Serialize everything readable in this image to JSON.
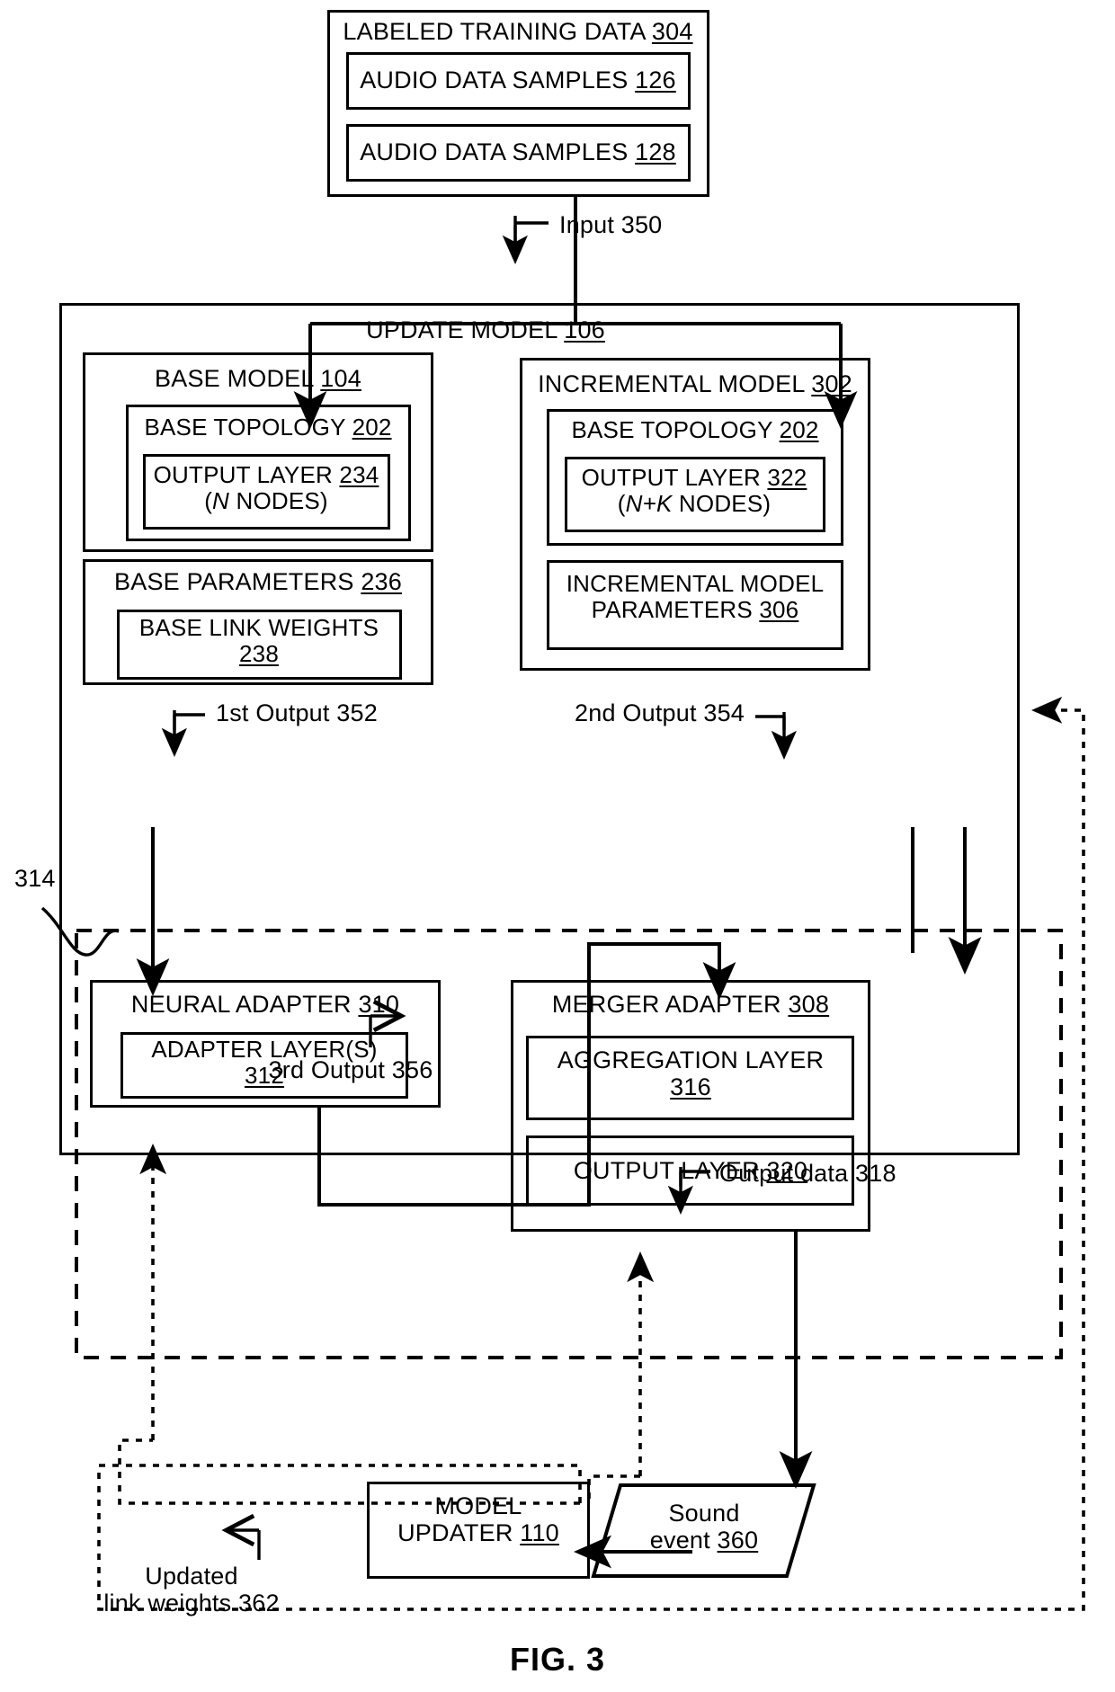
{
  "figure": {
    "caption": "FIG. 3"
  },
  "training_data": {
    "title": "LABELED TRAINING DATA",
    "ref": "304",
    "samples": [
      {
        "label": "AUDIO DATA SAMPLES",
        "ref": "126"
      },
      {
        "label": "AUDIO DATA SAMPLES",
        "ref": "128"
      }
    ]
  },
  "update_model": {
    "title": "UPDATE MODEL",
    "ref": "106",
    "base_model": {
      "title": "BASE MODEL",
      "ref": "104",
      "topology": {
        "title": "BASE TOPOLOGY",
        "ref": "202",
        "output_layer": {
          "title": "OUTPUT LAYER",
          "ref": "234",
          "nodes": "(N NODES)",
          "nodes_symbol": "N",
          "nodes_suffix": " NODES)",
          "nodes_prefix": "("
        }
      },
      "parameters": {
        "title": "BASE PARAMETERS",
        "ref": "236",
        "link_weights": {
          "title": "BASE LINK WEIGHTS",
          "ref": "238"
        }
      }
    },
    "incremental_model": {
      "title": "INCREMENTAL MODEL",
      "ref": "302",
      "topology": {
        "title": "BASE TOPOLOGY",
        "ref": "202",
        "output_layer": {
          "title": "OUTPUT LAYER",
          "ref": "322",
          "nodes_prefix": "(",
          "nodes_symbol": "N+K",
          "nodes_suffix": " NODES)"
        }
      },
      "parameters": {
        "title_line1": "INCREMENTAL MODEL",
        "title_line2": "PARAMETERS",
        "ref": "306"
      }
    },
    "neural_adapter": {
      "title": "NEURAL ADAPTER",
      "ref": "310",
      "adapter_layers": {
        "title": "ADAPTER LAYER(S)",
        "ref": "312"
      }
    },
    "merger_adapter": {
      "title": "MERGER ADAPTER",
      "ref": "308",
      "aggregation_layer": {
        "title": "AGGREGATION LAYER",
        "ref": "316"
      },
      "output_layer": {
        "title": "OUTPUT LAYER",
        "ref": "320"
      }
    },
    "dashed_region_ref": "314"
  },
  "model_updater": {
    "title_line1": "MODEL",
    "title_line2": "UPDATER",
    "ref": "110"
  },
  "sound_event": {
    "line1": "Sound",
    "line2_label": "event",
    "ref": "360"
  },
  "flow_labels": {
    "input": "Input 350",
    "first_output": "1st Output 352",
    "second_output": "2nd Output 354",
    "third_output": "3rd Output 356",
    "output_data": "Output data 318",
    "updated_weights_line1": "Updated",
    "updated_weights_line2": "link weights 362"
  }
}
